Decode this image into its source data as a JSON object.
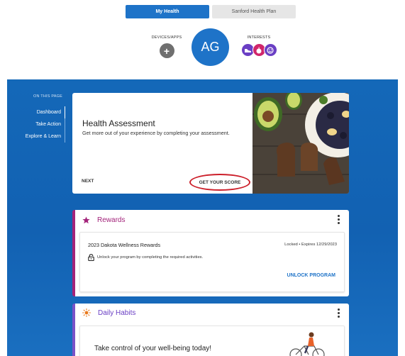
{
  "tabs": {
    "my_health": "My Health",
    "plan": "Sanford Health Plan"
  },
  "profile": {
    "devices_label": "DEVICES/APPS",
    "avatar_initials": "AG",
    "interests_label": "INTERESTS"
  },
  "colors": {
    "primary_blue": "#1e73c8",
    "band_blue": "#1468b8",
    "rewards_accent": "#a3237a",
    "habits_accent": "#6a3fc4",
    "highlight_red": "#cc1f2a"
  },
  "sidebar": {
    "heading": "ON THIS PAGE",
    "items": [
      {
        "label": "Dashboard",
        "selected": true
      },
      {
        "label": "Take Action",
        "selected": false
      },
      {
        "label": "Explore & Learn",
        "selected": false
      }
    ]
  },
  "health_assessment": {
    "title": "Health Assessment",
    "description": "Get more out of your experience by completing your assessment.",
    "next_label": "NEXT",
    "score_label": "GET YOUR SCORE"
  },
  "rewards": {
    "title": "Rewards",
    "program_name": "2023 Dakota Wellness Rewards",
    "status": "Locked • Expires 12/29/2023",
    "unlock_text": "Unlock your program by completing the required activities.",
    "unlock_button": "UNLOCK PROGRAM"
  },
  "daily_habits": {
    "title": "Daily Habits",
    "message": "Take control of your well-being today!"
  },
  "icons": [
    "plus-icon",
    "avatar",
    "shoe-icon",
    "apple-icon",
    "smile-icon",
    "star-icon",
    "lock-icon",
    "sun-icon",
    "kebab-menu-icon"
  ]
}
